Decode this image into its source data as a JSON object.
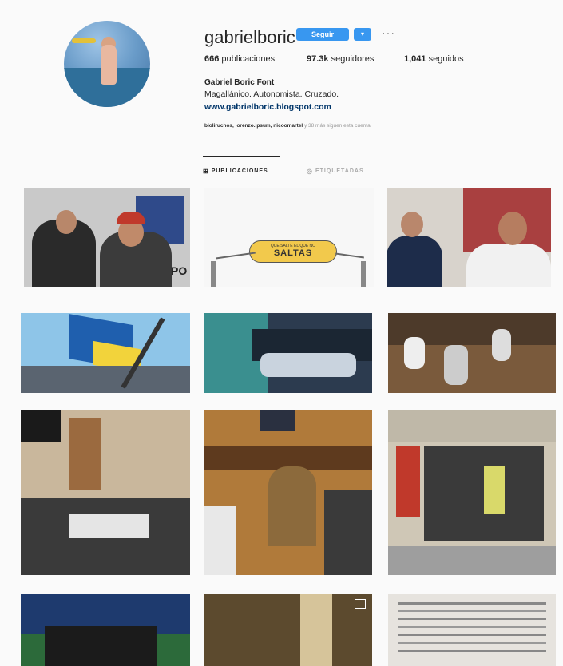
{
  "profile": {
    "username": "gabrielboric",
    "follow_label": "Seguir",
    "dropdown_icon": "chevron-down-icon",
    "more_icon": "more-icon",
    "posts_count": "666",
    "posts_label": "publicaciones",
    "followers_count": "97.3k",
    "followers_label": "seguidores",
    "following_count": "1,041",
    "following_label": "seguidos",
    "full_name": "Gabriel Boric Font",
    "bio": "Magallánico. Autonomista. Cruzado.",
    "website": "www.gabrielboric.blogspot.com",
    "followed_by_names": "bioliruchos, lorenzo.ipsum, nicoomartel",
    "followed_by_rest": "y 38 más siguen esta cuenta"
  },
  "tabs": {
    "posts": "PUBLICACIONES",
    "tagged": "ETIQUETADAS"
  },
  "photo_texts": {
    "sign_word": "PO",
    "banner_small": "QUE SALTE EL QUE NO",
    "banner_big": "SALTAS"
  },
  "colors": {
    "follow_blue": "#3897f0",
    "link_blue": "#003569"
  }
}
